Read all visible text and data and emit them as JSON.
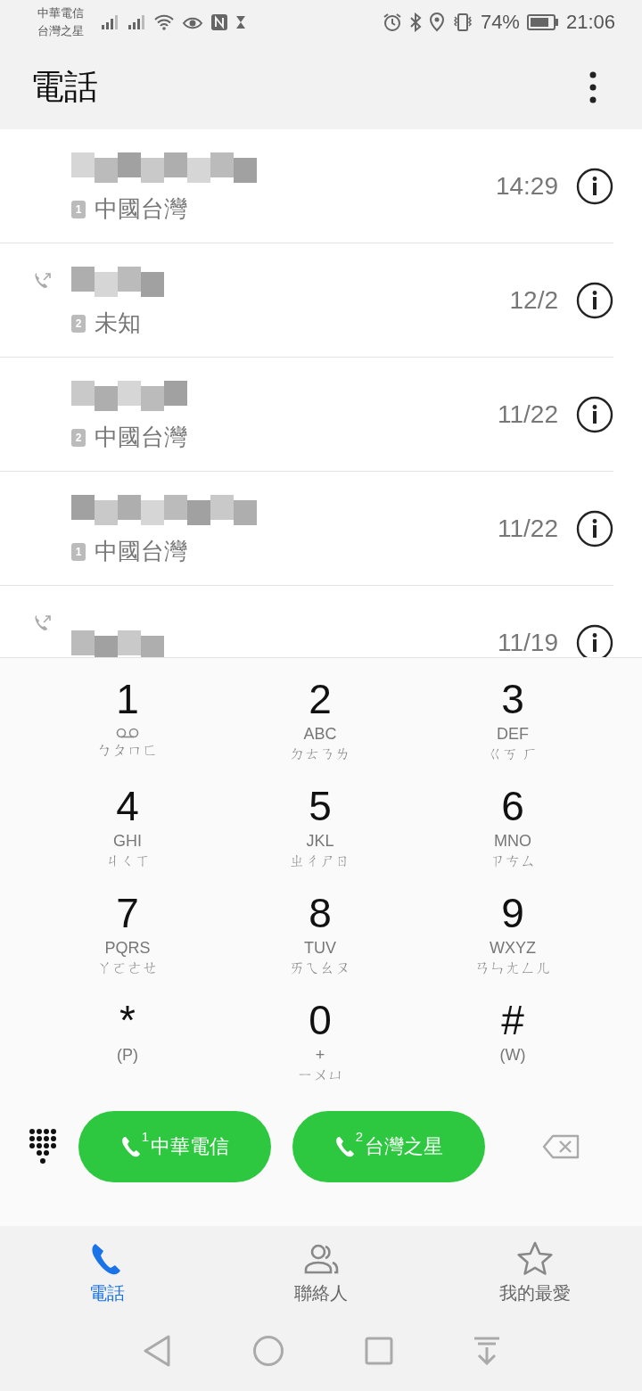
{
  "status_bar": {
    "carriers": [
      "中華電信",
      "台灣之星"
    ],
    "battery": "74%",
    "time": "21:06"
  },
  "header": {
    "title": "電話"
  },
  "calls": [
    {
      "outgoing": false,
      "sim": "1",
      "location": "中國台灣",
      "time": "14:29"
    },
    {
      "outgoing": true,
      "sim": "2",
      "location": "未知",
      "time": "12/2"
    },
    {
      "outgoing": false,
      "sim": "2",
      "location": "中國台灣",
      "time": "11/22"
    },
    {
      "outgoing": false,
      "sim": "1",
      "location": "中國台灣",
      "time": "11/22"
    },
    {
      "outgoing": true,
      "time": "11/19"
    }
  ],
  "keypad": [
    {
      "digit": "1",
      "kind": "voicemail",
      "zhuyin": "ㄅㄆㄇㄈ"
    },
    {
      "digit": "2",
      "kind": "letters",
      "letters": "ABC",
      "zhuyin": "ㄉㄊㄋㄌ"
    },
    {
      "digit": "3",
      "kind": "letters",
      "letters": "DEF",
      "zhuyin": "ㄍㄎ ㄏ"
    },
    {
      "digit": "4",
      "kind": "letters",
      "letters": "GHI",
      "zhuyin": "ㄐㄑㄒ"
    },
    {
      "digit": "5",
      "kind": "letters",
      "letters": "JKL",
      "zhuyin": "ㄓㄔㄕㄖ"
    },
    {
      "digit": "6",
      "kind": "letters",
      "letters": "MNO",
      "zhuyin": "ㄗㄘㄙ"
    },
    {
      "digit": "7",
      "kind": "letters",
      "letters": "PQRS",
      "zhuyin": "ㄚㄛㄜㄝ"
    },
    {
      "digit": "8",
      "kind": "letters",
      "letters": "TUV",
      "zhuyin": "ㄞㄟㄠㄡ"
    },
    {
      "digit": "9",
      "kind": "letters",
      "letters": "WXYZ",
      "zhuyin": "ㄢㄣㄤㄥㄦ"
    },
    {
      "digit": "*",
      "kind": "letters",
      "letters": "(P)"
    },
    {
      "digit": "0",
      "kind": "letters",
      "letters": "+",
      "zhuyin": "ㄧㄨㄩ"
    },
    {
      "digit": "#",
      "kind": "letters",
      "letters": "(W)"
    }
  ],
  "call_buttons": [
    {
      "sim": "1",
      "label": "中華電信"
    },
    {
      "sim": "2",
      "label": "台灣之星"
    }
  ],
  "tabs": [
    {
      "label": "電話",
      "selected": true,
      "kind": "phone"
    },
    {
      "label": "聯絡人",
      "selected": false,
      "kind": "contacts"
    },
    {
      "label": "我的最愛",
      "selected": false,
      "kind": "favorites"
    }
  ]
}
